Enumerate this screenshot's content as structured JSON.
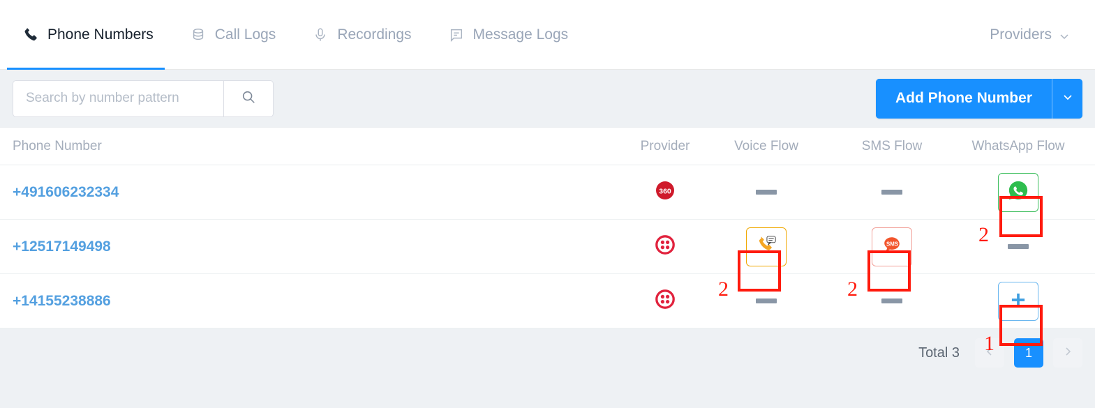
{
  "tabs": [
    {
      "label": "Phone Numbers",
      "icon": "phone-icon",
      "active": true
    },
    {
      "label": "Call Logs",
      "icon": "database-icon",
      "active": false
    },
    {
      "label": "Recordings",
      "icon": "microphone-icon",
      "active": false
    },
    {
      "label": "Message Logs",
      "icon": "message-icon",
      "active": false
    }
  ],
  "header": {
    "providers_label": "Providers",
    "providers_icon": "chevron-down-icon"
  },
  "toolbar": {
    "search_placeholder": "Search by number pattern",
    "search_value": "",
    "search_icon": "search-icon",
    "add_label": "Add Phone Number",
    "add_caret_icon": "chevron-down-icon"
  },
  "table": {
    "columns": [
      "Phone Number",
      "Provider",
      "Voice Flow",
      "SMS Flow",
      "WhatsApp Flow"
    ],
    "rows": [
      {
        "number": "+491606232334",
        "provider_icon": "360dialog-logo-icon",
        "voice": {
          "type": "empty",
          "icon": "dash-icon"
        },
        "sms": {
          "type": "empty",
          "icon": "dash-icon"
        },
        "whatsapp": {
          "type": "flow",
          "icon": "whatsapp-icon",
          "style": "green"
        }
      },
      {
        "number": "+12517149498",
        "provider_icon": "twilio-logo-icon",
        "voice": {
          "type": "flow",
          "icon": "voice-flow-icon",
          "style": "orange"
        },
        "sms": {
          "type": "flow",
          "icon": "sms-icon",
          "style": "red"
        },
        "whatsapp": {
          "type": "empty",
          "icon": "dash-icon"
        }
      },
      {
        "number": "+14155238886",
        "provider_icon": "twilio-logo-icon",
        "voice": {
          "type": "empty",
          "icon": "dash-icon"
        },
        "sms": {
          "type": "empty",
          "icon": "dash-icon"
        },
        "whatsapp": {
          "type": "add",
          "icon": "plus-icon",
          "style": "blue"
        }
      }
    ]
  },
  "annotations": [
    {
      "label": "2",
      "target": "whatsapp-flow-button-row-1"
    },
    {
      "label": "2",
      "target": "voice-flow-button-row-2"
    },
    {
      "label": "2",
      "target": "sms-flow-button-row-2"
    },
    {
      "label": "1",
      "target": "add-whatsapp-flow-button-row-3"
    }
  ],
  "footer": {
    "total_label": "Total 3",
    "prev_icon": "chevron-left-icon",
    "next_icon": "chevron-right-icon",
    "current_page": "1"
  },
  "colors": {
    "accent": "#1890ff",
    "link": "#54a0e0",
    "annotation": "#ff1a0d",
    "whatsapp_green": "#3fbf5f",
    "voice_orange": "#f0a800",
    "sms_red": "#f2552c",
    "provider_red": "#e1223d"
  }
}
